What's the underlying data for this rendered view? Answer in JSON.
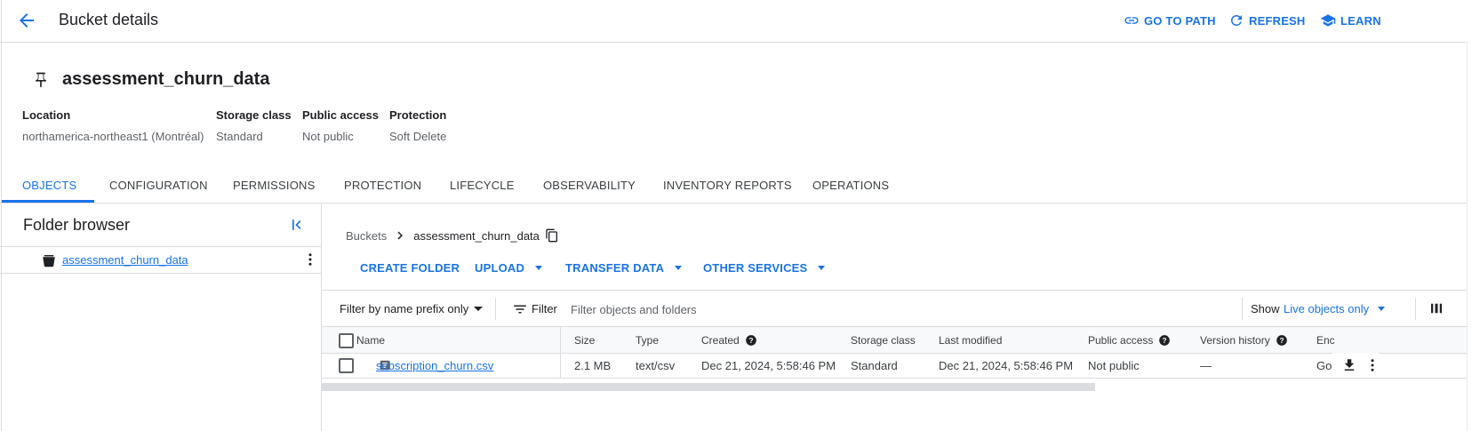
{
  "header": {
    "title": "Bucket details",
    "go_to_path": "GO TO PATH",
    "refresh": "REFRESH",
    "learn": "LEARN"
  },
  "bucket": {
    "name": "assessment_churn_data",
    "meta": [
      {
        "label": "Location",
        "value": "northamerica-northeast1 (Montréal)"
      },
      {
        "label": "Storage class",
        "value": "Standard"
      },
      {
        "label": "Public access",
        "value": "Not public"
      },
      {
        "label": "Protection",
        "value": "Soft Delete"
      }
    ]
  },
  "tabs": [
    "OBJECTS",
    "CONFIGURATION",
    "PERMISSIONS",
    "PROTECTION",
    "LIFECYCLE",
    "OBSERVABILITY",
    "INVENTORY REPORTS",
    "OPERATIONS"
  ],
  "active_tab": "OBJECTS",
  "folder_browser": {
    "title": "Folder browser",
    "items": [
      {
        "label": "assessment_churn_data"
      }
    ]
  },
  "breadcrumb": {
    "root": "Buckets",
    "current": "assessment_churn_data"
  },
  "actions": {
    "create_folder": "CREATE FOLDER",
    "upload": "UPLOAD",
    "transfer_data": "TRANSFER DATA",
    "other_services": "OTHER SERVICES"
  },
  "filter": {
    "prefix_mode": "Filter by name prefix only",
    "label": "Filter",
    "placeholder": "Filter objects and folders",
    "show_label": "Show",
    "show_value": "Live objects only"
  },
  "table": {
    "columns": [
      "Name",
      "Size",
      "Type",
      "Created",
      "Storage class",
      "Last modified",
      "Public access",
      "Version history",
      "Enc"
    ],
    "rows": [
      {
        "name": "subscription_churn.csv",
        "size": "2.1 MB",
        "type": "text/csv",
        "created": "Dec 21, 2024, 5:58:46 PM",
        "storage_class": "Standard",
        "last_modified": "Dec 21, 2024, 5:58:46 PM",
        "public_access": "Not public",
        "version_history": "—",
        "encryption": "Goo"
      }
    ]
  },
  "colors": {
    "accent": "#1a73e8",
    "border": "#dadce0",
    "text": "#202124",
    "muted": "#5f6368"
  }
}
